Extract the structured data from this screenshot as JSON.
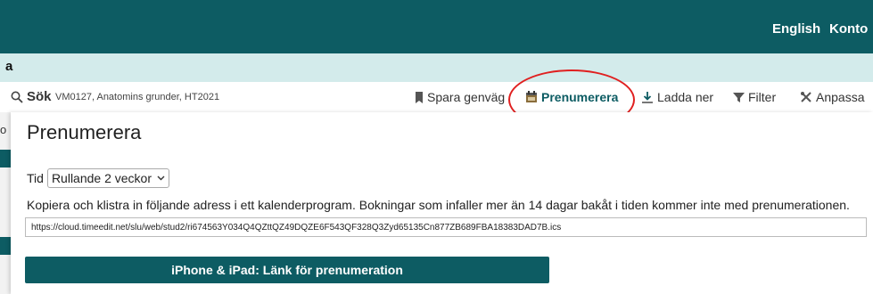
{
  "header": {
    "language_label": "English",
    "account_label": "Konto"
  },
  "subbar": {
    "crumb": "a"
  },
  "toolbar": {
    "search_label": "Sök",
    "search_value": "VM0127, Anatomins grunder, HT2021",
    "save_shortcut_label": "Spara genväg",
    "subscribe_label": "Prenumerera",
    "download_label": "Ladda ner",
    "filter_label": "Filter",
    "customize_label": "Anpassa"
  },
  "left_strip": {
    "letter": "o"
  },
  "panel": {
    "title": "Prenumerera",
    "time_label": "Tid",
    "time_value": "Rullande 2 veckor",
    "instructions": "Kopiera och klistra in följande adress i ett kalenderprogram. Bokningar som infaller mer än 14 dagar bakåt i tiden kommer inte med prenumerationen.",
    "url": "https://cloud.timeedit.net/slu/web/stud2/ri674563Y034Q4QZttQZ49DQZE6F543QF328Q3Zyd65135Cn877ZB689FBA18383DAD7B.ics",
    "iphone_button_label": "iPhone & iPad: Länk för prenumeration"
  },
  "colors": {
    "brand_teal": "#0d5c63",
    "subbar_bg": "#d3ebeb",
    "highlight_circle": "#e02020"
  }
}
